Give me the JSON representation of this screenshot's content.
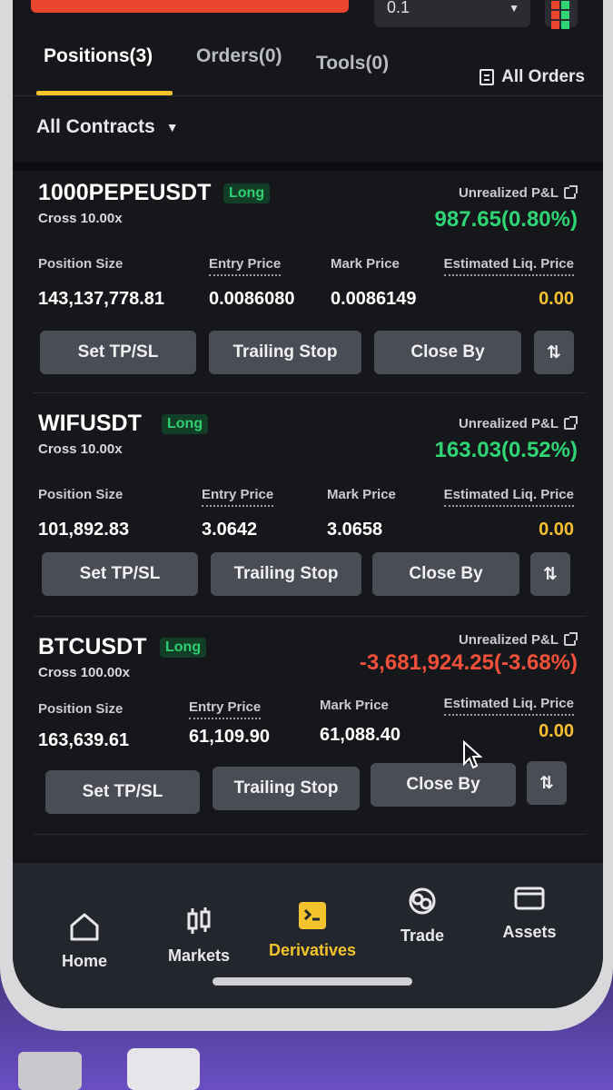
{
  "top": {
    "leverage_value": "0.1"
  },
  "tabs": {
    "positions": "Positions(3)",
    "orders": "Orders(0)",
    "tools": "Tools(0)",
    "all_orders": "All Orders"
  },
  "filter": {
    "label": "All Contracts"
  },
  "labels": {
    "unrealized_pnl": "Unrealized P&L",
    "position_size": "Position Size",
    "entry_price": "Entry Price",
    "mark_price": "Mark Price",
    "est_liq_price": "Estimated Liq. Price",
    "set_tpsl": "Set TP/SL",
    "trailing_stop": "Trailing Stop",
    "close_by": "Close By"
  },
  "positions": [
    {
      "symbol": "1000PEPEUSDT",
      "side": "Long",
      "margin": "Cross 10.00x",
      "pnl": "987.65(0.80%)",
      "pnl_sign": "positive",
      "size": "143,137,778.81",
      "entry": "0.0086080",
      "mark": "0.0086149",
      "liq": "0.00"
    },
    {
      "symbol": "WIFUSDT",
      "side": "Long",
      "margin": "Cross 10.00x",
      "pnl": "163.03(0.52%)",
      "pnl_sign": "positive",
      "size": "101,892.83",
      "entry": "3.0642",
      "mark": "3.0658",
      "liq": "0.00"
    },
    {
      "symbol": "BTCUSDT",
      "side": "Long",
      "margin": "Cross 100.00x",
      "pnl": "-3,681,924.25(-3.68%)",
      "pnl_sign": "negative",
      "size": "163,639.61",
      "entry": "61,109.90",
      "mark": "61,088.40",
      "liq": "0.00"
    }
  ],
  "nav": [
    {
      "label": "Home",
      "icon": "home-icon"
    },
    {
      "label": "Markets",
      "icon": "candlestick-icon"
    },
    {
      "label": "Derivatives",
      "icon": "derivatives-icon",
      "active": true
    },
    {
      "label": "Trade",
      "icon": "trade-icon"
    },
    {
      "label": "Assets",
      "icon": "wallet-icon"
    }
  ],
  "colors": {
    "accent": "#f3c32b",
    "profit": "#2fd474",
    "loss": "#f0503a",
    "liq": "#f5c02f"
  }
}
